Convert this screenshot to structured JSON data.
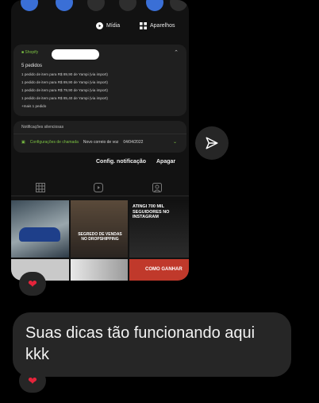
{
  "media_bar": {
    "media_label": "Mídia",
    "devices_label": "Aparelhos"
  },
  "notification": {
    "app_name": "Shopify",
    "title": "5 pedidos",
    "lines": [
      "1 pedido de item para R$ 89,90 de Yampi (via import)",
      "1 pedido de item para R$ 89,90 de Yampi (via import)",
      "1 pedido de item para R$ 79,90 de Yampi (via import)",
      "1 pedido de item para R$ 85,40 de Yampi (via import)",
      "+mais 1 pedido"
    ]
  },
  "silent": {
    "label": "Notificações silenciosas",
    "app": "Configurações de chamada",
    "text": "Novo correio de voz",
    "date": "04/04/2022"
  },
  "actions": {
    "settings": "Config. notificação",
    "clear": "Apagar"
  },
  "tiles": {
    "t2_caption": "SEGREDO DE VENDAS NO DROPSHIPPING",
    "t3_caption": "ATINGI 700 MIL SEGUIDORES NO INSTAGRAM",
    "t6_caption": "COMO GANHAR"
  },
  "message": {
    "text": "Suas dicas tão funcionando aqui kkk"
  },
  "reaction": "❤",
  "colors": {
    "accent_green": "#7cc243",
    "heart": "#e5243b",
    "bubble": "#262626"
  }
}
